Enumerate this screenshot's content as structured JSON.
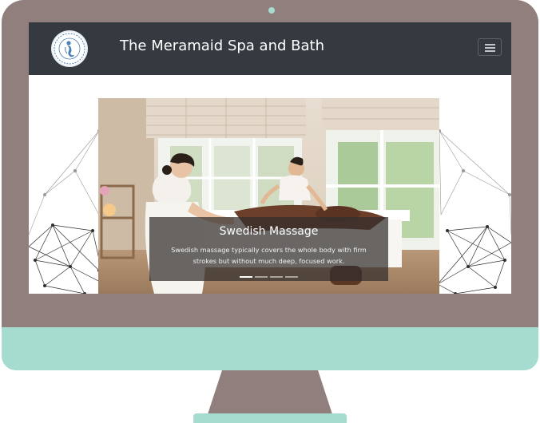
{
  "navbar": {
    "brand": "The Meramaid Spa and Bath",
    "logo_icon": "mermaid-logo-icon",
    "menu_icon": "hamburger-menu-icon"
  },
  "carousel": {
    "active_index": 0,
    "slide_count": 4,
    "slide": {
      "title": "Swedish Massage",
      "text": "Swedish massage typically covers the whole body with firm strokes but without much deep, focused work."
    }
  },
  "colors": {
    "monitor_frame": "#917f7e",
    "monitor_accent": "#a6dccf",
    "navbar_bg": "#343a40"
  }
}
